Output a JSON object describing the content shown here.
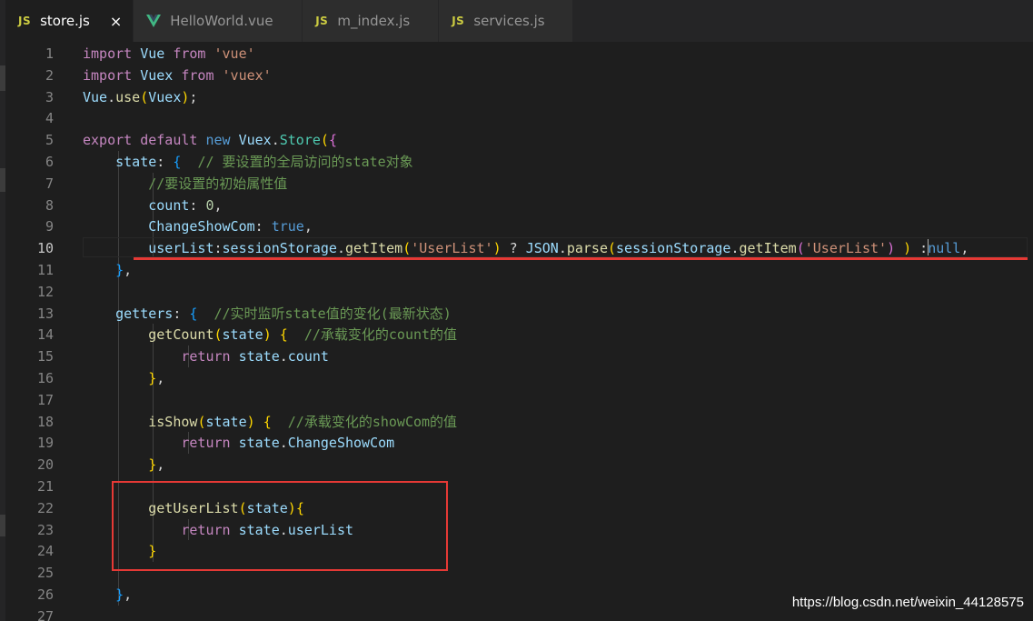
{
  "tabs": [
    {
      "label": "store.js",
      "type": "js",
      "active": true
    },
    {
      "label": "HelloWorld.vue",
      "type": "vue",
      "active": false
    },
    {
      "label": "m_index.js",
      "type": "js",
      "active": false
    },
    {
      "label": "services.js",
      "type": "js",
      "active": false
    }
  ],
  "js_badge": "JS",
  "close_glyph": "×",
  "icon_names": {
    "js": "javascript-file-icon",
    "vue": "vue-file-icon"
  },
  "colors": {
    "background": "#1e1e1e",
    "keyword": "#c586c0",
    "string": "#ce9178",
    "comment": "#6a9955",
    "annotation_red": "#e53935"
  },
  "current_line": 10,
  "line_numbers": [
    "1",
    "2",
    "3",
    "4",
    "5",
    "6",
    "7",
    "8",
    "9",
    "10",
    "11",
    "12",
    "13",
    "14",
    "15",
    "16",
    "17",
    "18",
    "19",
    "20",
    "21",
    "22",
    "23",
    "24",
    "25",
    "26",
    "27"
  ],
  "code_lines": [
    [
      [
        "kw",
        "import"
      ],
      [
        "p",
        " "
      ],
      [
        "id",
        "Vue"
      ],
      [
        "p",
        " "
      ],
      [
        "kw",
        "from"
      ],
      [
        "p",
        " "
      ],
      [
        "str",
        "'vue'"
      ]
    ],
    [
      [
        "kw",
        "import"
      ],
      [
        "p",
        " "
      ],
      [
        "id",
        "Vuex"
      ],
      [
        "p",
        " "
      ],
      [
        "kw",
        "from"
      ],
      [
        "p",
        " "
      ],
      [
        "str",
        "'vuex'"
      ]
    ],
    [
      [
        "id",
        "Vue"
      ],
      [
        "p",
        "."
      ],
      [
        "fn",
        "use"
      ],
      [
        "b1",
        "("
      ],
      [
        "id",
        "Vuex"
      ],
      [
        "b1",
        ")"
      ],
      [
        "p",
        ";"
      ]
    ],
    [],
    [
      [
        "kw",
        "export"
      ],
      [
        "p",
        " "
      ],
      [
        "kw",
        "default"
      ],
      [
        "p",
        " "
      ],
      [
        "bool",
        "new"
      ],
      [
        "p",
        " "
      ],
      [
        "id",
        "Vuex"
      ],
      [
        "p",
        "."
      ],
      [
        "cls",
        "Store"
      ],
      [
        "b1",
        "("
      ],
      [
        "b2",
        "{"
      ]
    ],
    [
      [
        "p",
        "    "
      ],
      [
        "id",
        "state"
      ],
      [
        "p",
        ": "
      ],
      [
        "b3",
        "{"
      ],
      [
        "p",
        "  "
      ],
      [
        "cm",
        "// 要设置的全局访问的state对象"
      ]
    ],
    [
      [
        "p",
        "        "
      ],
      [
        "cm",
        "//要设置的初始属性值"
      ]
    ],
    [
      [
        "p",
        "        "
      ],
      [
        "id",
        "count"
      ],
      [
        "p",
        ": "
      ],
      [
        "num",
        "0"
      ],
      [
        "p",
        ","
      ]
    ],
    [
      [
        "p",
        "        "
      ],
      [
        "id",
        "ChangeShowCom"
      ],
      [
        "p",
        ": "
      ],
      [
        "bool",
        "true"
      ],
      [
        "p",
        ","
      ]
    ],
    [
      [
        "p",
        "        "
      ],
      [
        "id",
        "userList"
      ],
      [
        "p",
        ":"
      ],
      [
        "id",
        "sessionStorage"
      ],
      [
        "p",
        "."
      ],
      [
        "fn",
        "getItem"
      ],
      [
        "b1",
        "("
      ],
      [
        "str",
        "'UserList'"
      ],
      [
        "b1",
        ")"
      ],
      [
        "p",
        " ? "
      ],
      [
        "id",
        "JSON"
      ],
      [
        "p",
        "."
      ],
      [
        "fn",
        "parse"
      ],
      [
        "b1",
        "("
      ],
      [
        "id",
        "sessionStorage"
      ],
      [
        "p",
        "."
      ],
      [
        "fn",
        "getItem"
      ],
      [
        "b2",
        "("
      ],
      [
        "str",
        "'UserList'"
      ],
      [
        "b2",
        ")"
      ],
      [
        "p",
        " "
      ],
      [
        "b1",
        ")"
      ],
      [
        "p",
        " :"
      ],
      [
        "bool",
        "null"
      ],
      [
        "p",
        ","
      ]
    ],
    [
      [
        "p",
        "    "
      ],
      [
        "b3",
        "}"
      ],
      [
        "p",
        ","
      ]
    ],
    [],
    [
      [
        "p",
        "    "
      ],
      [
        "id",
        "getters"
      ],
      [
        "p",
        ": "
      ],
      [
        "b3",
        "{"
      ],
      [
        "p",
        "  "
      ],
      [
        "cm",
        "//实时监听state值的变化(最新状态)"
      ]
    ],
    [
      [
        "p",
        "        "
      ],
      [
        "fn",
        "getCount"
      ],
      [
        "b1",
        "("
      ],
      [
        "id",
        "state"
      ],
      [
        "b1",
        ")"
      ],
      [
        "p",
        " "
      ],
      [
        "b1",
        "{"
      ],
      [
        "p",
        "  "
      ],
      [
        "cm",
        "//承载变化的count的值"
      ]
    ],
    [
      [
        "p",
        "            "
      ],
      [
        "kw",
        "return"
      ],
      [
        "p",
        " "
      ],
      [
        "id",
        "state"
      ],
      [
        "p",
        "."
      ],
      [
        "id",
        "count"
      ]
    ],
    [
      [
        "p",
        "        "
      ],
      [
        "b1",
        "}"
      ],
      [
        "p",
        ","
      ]
    ],
    [],
    [
      [
        "p",
        "        "
      ],
      [
        "fn",
        "isShow"
      ],
      [
        "b1",
        "("
      ],
      [
        "id",
        "state"
      ],
      [
        "b1",
        ")"
      ],
      [
        "p",
        " "
      ],
      [
        "b1",
        "{"
      ],
      [
        "p",
        "  "
      ],
      [
        "cm",
        "//承载变化的showCom的值"
      ]
    ],
    [
      [
        "p",
        "            "
      ],
      [
        "kw",
        "return"
      ],
      [
        "p",
        " "
      ],
      [
        "id",
        "state"
      ],
      [
        "p",
        "."
      ],
      [
        "id",
        "ChangeShowCom"
      ]
    ],
    [
      [
        "p",
        "        "
      ],
      [
        "b1",
        "}"
      ],
      [
        "p",
        ","
      ]
    ],
    [],
    [
      [
        "p",
        "        "
      ],
      [
        "fn",
        "getUserList"
      ],
      [
        "b1",
        "("
      ],
      [
        "id",
        "state"
      ],
      [
        "b1",
        ")"
      ],
      [
        "b1",
        "{"
      ]
    ],
    [
      [
        "p",
        "            "
      ],
      [
        "kw",
        "return"
      ],
      [
        "p",
        " "
      ],
      [
        "id",
        "state"
      ],
      [
        "p",
        "."
      ],
      [
        "id",
        "userList"
      ]
    ],
    [
      [
        "p",
        "        "
      ],
      [
        "b1",
        "}"
      ]
    ],
    [],
    [
      [
        "p",
        "    "
      ],
      [
        "b3",
        "}"
      ],
      [
        "p",
        ","
      ]
    ],
    []
  ],
  "watermark": "https://blog.csdn.net/weixin_44128575"
}
